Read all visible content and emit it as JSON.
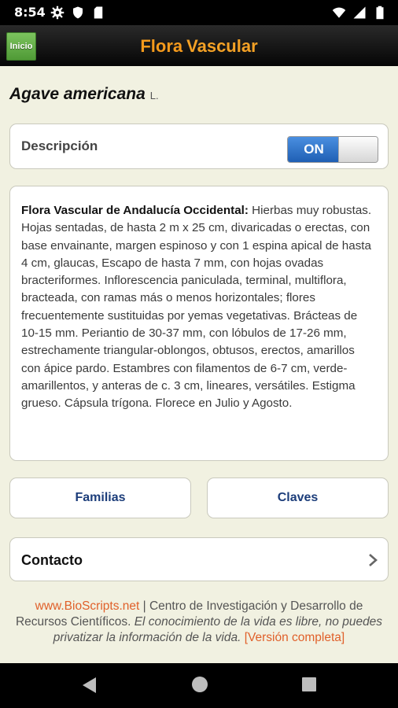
{
  "status_bar": {
    "time": "8:54"
  },
  "app_bar": {
    "home_label": "Inicio",
    "title_part1": "Flora",
    "title_part2": "Vascular"
  },
  "species": {
    "name": "Agave americana",
    "author": "L."
  },
  "description_toggle": {
    "label": "Descripción",
    "state_label": "ON",
    "state": true
  },
  "description": {
    "source": "Flora Vascular de Andalucía Occidental:",
    "text": " Hierbas muy robustas. Hojas sentadas, de hasta 2 m x 25 cm, divaricadas o erectas, con base envainante, margen espinoso y con 1 espina apical de hasta 4 cm, glaucas, Escapo de hasta 7 mm, con hojas ovadas bracteriformes. Inflorescencia paniculada, terminal, multiflora, bracteada, con ramas más o menos horizontales; flores frecuentemente sustituidas por yemas vegetativas. Brácteas de 10-15 mm. Periantio de 30-37 mm, con lóbulos de 17-26 mm, estrechamente triangular-oblongos, obtusos, erectos, amarillos con ápice pardo. Estambres con filamentos de 6-7 cm, verde-amarillentos, y anteras de c. 3 cm, lineares, versátiles. Estigma grueso. Cápsula trígona. Florece en Julio y Agosto."
  },
  "buttons": {
    "familias": "Familias",
    "claves": "Claves",
    "contacto": "Contacto"
  },
  "footer": {
    "link": "www.BioScripts.net",
    "sep": " | ",
    "org": "Centro de Investigación y Desarrollo de Recursos Científicos.",
    "motto": " El conocimiento de la vida es libre, no puedes privatizar la información de la vida.",
    "full_version": " [Versión completa]"
  },
  "colors": {
    "title": "#f59a1c",
    "toggle_on": "#2e6fc7",
    "link": "#e0602a",
    "button_text": "#1c3d7a",
    "background": "#f1f1e1"
  },
  "icons": [
    "gear-icon",
    "shield-icon",
    "sd-card-icon",
    "wifi-icon",
    "signal-icon",
    "battery-icon",
    "chevron-right-icon",
    "back-icon",
    "home-icon",
    "recents-icon"
  ]
}
